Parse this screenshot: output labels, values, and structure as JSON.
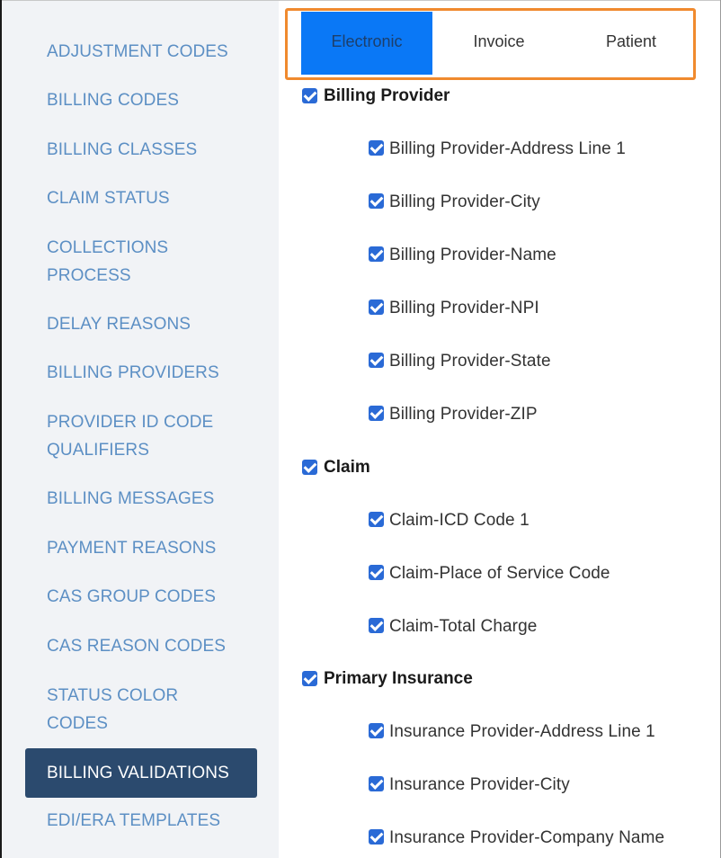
{
  "sidebar": {
    "items": [
      "ADJUSTMENT CODES",
      "BILLING CODES",
      "BILLING CLASSES",
      "CLAIM STATUS",
      "COLLECTIONS PROCESS",
      "DELAY REASONS",
      "BILLING PROVIDERS",
      "PROVIDER ID CODE QUALIFIERS",
      "BILLING MESSAGES",
      "PAYMENT REASONS",
      "CAS GROUP CODES",
      "CAS REASON CODES",
      "STATUS COLOR CODES",
      "BILLING VALIDATIONS",
      "EDI/ERA TEMPLATES"
    ],
    "active_item": "BILLING VALIDATIONS"
  },
  "tabs": [
    "Electronic",
    "Invoice",
    "Patient"
  ],
  "active_tab": "Electronic",
  "groups": [
    {
      "label": "Billing Provider",
      "checked": true,
      "items": [
        "Billing Provider-Address Line 1",
        "Billing Provider-City",
        "Billing Provider-Name",
        "Billing Provider-NPI",
        "Billing Provider-State",
        "Billing Provider-ZIP"
      ]
    },
    {
      "label": "Claim",
      "checked": true,
      "items": [
        "Claim-ICD Code 1",
        "Claim-Place of Service Code",
        "Claim-Total Charge"
      ]
    },
    {
      "label": "Primary Insurance",
      "checked": true,
      "items": [
        "Insurance Provider-Address Line 1",
        "Insurance Provider-City",
        "Insurance Provider-Company Name"
      ]
    }
  ],
  "colors": {
    "sidebar_bg": "#f1f3f6",
    "sidebar_link": "#5c8fc4",
    "sidebar_active_bg": "#2b4a6e",
    "tab_active_bg": "#0a78f6",
    "tab_frame_border": "#f08a2e",
    "checkbox": "#2a6ad6"
  }
}
